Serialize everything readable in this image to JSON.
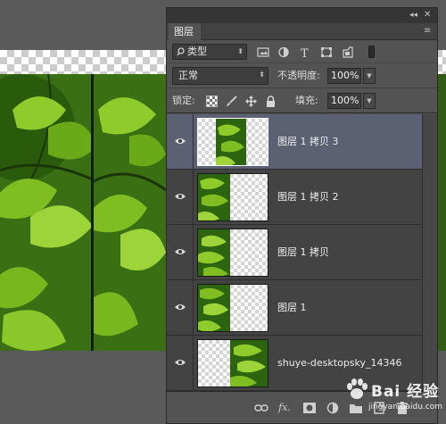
{
  "panel": {
    "tab_label": "图层",
    "filter": {
      "kind_label": "类型"
    },
    "blend": {
      "mode": "正常",
      "opacity_label": "不透明度:",
      "opacity_value": "100%"
    },
    "lock": {
      "label": "锁定:",
      "fill_label": "填充:",
      "fill_value": "100%"
    },
    "layers": [
      {
        "name": "图层 1 拷贝 3",
        "selected": true
      },
      {
        "name": "图层 1 拷贝 2",
        "selected": false
      },
      {
        "name": "图层 1 拷贝",
        "selected": false
      },
      {
        "name": "图层 1",
        "selected": false
      },
      {
        "name": "shuye-desktopsky_14346",
        "selected": false
      }
    ],
    "footer": {
      "fx_label": "fx."
    }
  },
  "colors": {
    "selected_row": "#5b6072",
    "panel_bg": "#535353",
    "leaf_green": "#7cbf1f",
    "dark_green": "#1f4a0c"
  },
  "watermark": {
    "text": "Bai 经验",
    "url": "jingyan.baidu.com"
  }
}
